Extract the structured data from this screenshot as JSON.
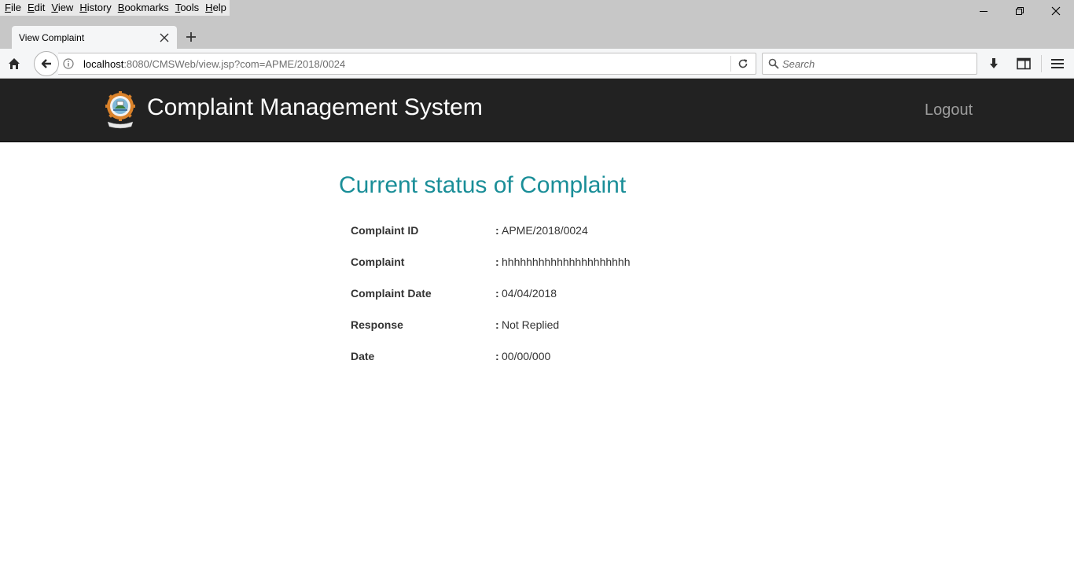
{
  "browser": {
    "menu": [
      {
        "label": "File",
        "accel": "F",
        "rest": "ile"
      },
      {
        "label": "Edit",
        "accel": "E",
        "rest": "dit"
      },
      {
        "label": "View",
        "accel": "V",
        "rest": "iew"
      },
      {
        "label": "History",
        "accel": "H",
        "rest": "istory"
      },
      {
        "label": "Bookmarks",
        "accel": "B",
        "rest": "ookmarks"
      },
      {
        "label": "Tools",
        "accel": "T",
        "rest": "ools"
      },
      {
        "label": "Help",
        "accel": "H",
        "rest": "elp"
      }
    ],
    "tab_title": "View Complaint",
    "url_host": "localhost",
    "url_rest": ":8080/CMSWeb/view.jsp?com=APME/2018/0024",
    "search_placeholder": "Search"
  },
  "site": {
    "title": "Complaint Management System",
    "logout_label": "Logout",
    "brand_color": "#222222",
    "accent_color": "#1a8e98"
  },
  "main": {
    "heading": "Current status of Complaint",
    "separator": ":",
    "details": [
      {
        "label": "Complaint ID",
        "value": "APME/2018/0024"
      },
      {
        "label": "Complaint",
        "value": "hhhhhhhhhhhhhhhhhhhhh"
      },
      {
        "label": "Complaint Date",
        "value": "04/04/2018"
      },
      {
        "label": "Response",
        "value": "Not Replied"
      },
      {
        "label": "Date",
        "value": "00/00/000"
      }
    ]
  }
}
